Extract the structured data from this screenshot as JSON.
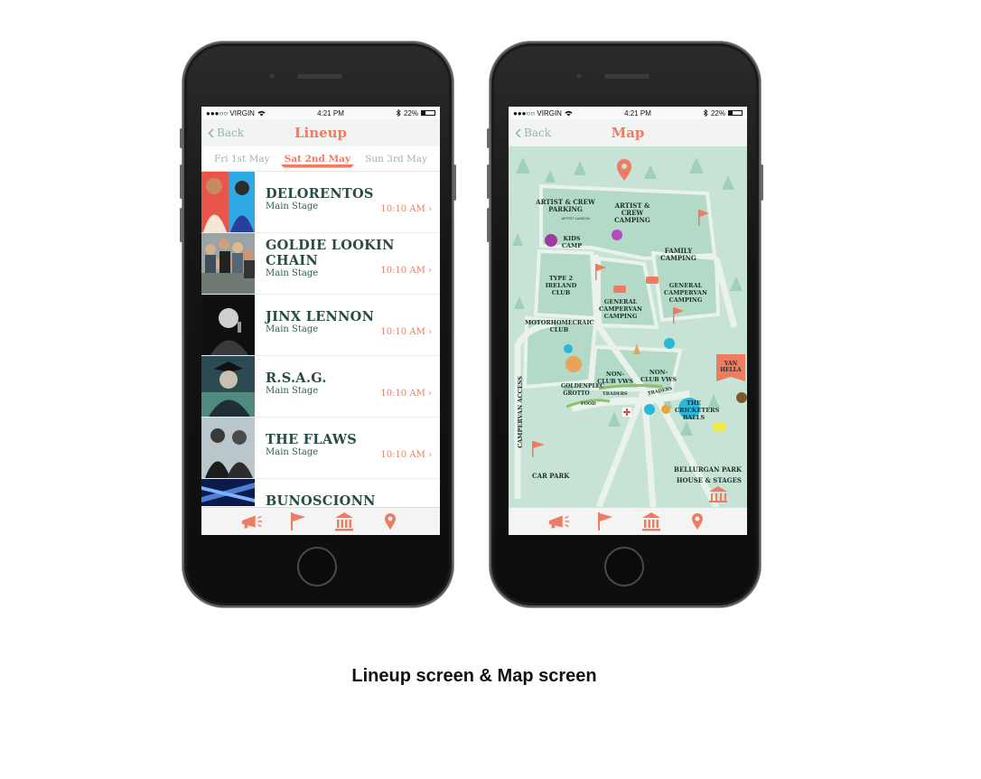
{
  "status_bar": {
    "carrier": "●●●○○ VIRGIN",
    "time": "4:21 PM",
    "battery": "22%"
  },
  "lineup_screen": {
    "back_label": "Back",
    "title": "Lineup",
    "days": [
      "Fri 1st May",
      "Sat 2nd May",
      "Sun 3rd May"
    ],
    "selected_day": "Sat 2nd May",
    "rows": [
      {
        "artist": "DELORENTOS",
        "stage": "Main Stage",
        "time": "10:10 AM"
      },
      {
        "artist": "GOLDIE LOOKIN CHAIN",
        "stage": "Main Stage",
        "time": "10:10 AM"
      },
      {
        "artist": "JINX LENNON",
        "stage": "Main Stage",
        "time": "10:10 AM"
      },
      {
        "artist": "R.S.A.G.",
        "stage": "Main Stage",
        "time": "10:10 AM"
      },
      {
        "artist": "THE FLAWS",
        "stage": "Main Stage",
        "time": "10:10 AM"
      },
      {
        "artist": "BUNOSCIONN",
        "stage": "",
        "time": ""
      }
    ]
  },
  "map_screen": {
    "back_label": "Back",
    "title": "Map",
    "labels": {
      "artist_parking": "ARTIST & CREW PARKING",
      "artist_liaison": "ARTIST LIAISON",
      "artist_camping": "ARTIST & CREW CAMPING",
      "kids_camp": "KIDS CAMP",
      "family_camping": "FAMILY CAMPING",
      "type2": "TYPE 2 IRELAND CLUB",
      "general_campervan_1": "GENERAL CAMPERVAN CAMPING",
      "general_campervan_2": "GENERAL CAMPERVAN CAMPING",
      "motorhome": "MOTORHOMECRAIC CLUB",
      "non_club_1": "NON-CLUB VWS",
      "non_club_2": "NON-CLUB VWS",
      "goldenplec": "GOLDENPLEC GROTTO",
      "traders_1": "TRADERS",
      "traders_2": "TRADERS",
      "food": "FOOD",
      "cricketers": "THE CRICKETERS BALLS",
      "van_hella": "VAN HELLA",
      "campervan_access": "CAMPERVAN ACCESS",
      "car_park": "CAR PARK",
      "bellurgan": "BELLURGAN PARK HOUSE & STAGES"
    }
  },
  "caption": "Lineup screen & Map screen",
  "colors": {
    "accent": "#ee7c63",
    "dark_text": "#294b46",
    "map_bg": "#c7e3d6",
    "map_path": "#e9f2ec"
  },
  "tab_icons": [
    "megaphone-icon",
    "flag-icon",
    "building-icon",
    "map-pin-icon"
  ]
}
